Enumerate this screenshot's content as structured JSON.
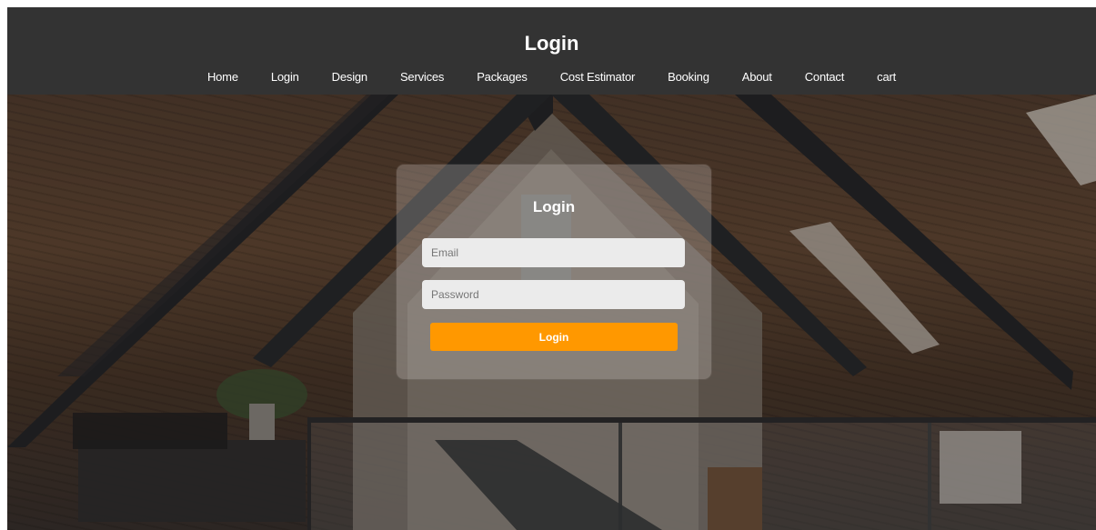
{
  "header": {
    "title": "Login",
    "nav": [
      "Home",
      "Login",
      "Design",
      "Services",
      "Packages",
      "Cost Estimator",
      "Booking",
      "About",
      "Contact",
      "cart"
    ]
  },
  "login_form": {
    "title": "Login",
    "email_placeholder": "Email",
    "password_placeholder": "Password",
    "submit_label": "Login"
  },
  "colors": {
    "header_bg": "#333333",
    "accent": "#ff9800",
    "card_bg": "rgba(215,210,205,0.28)"
  }
}
